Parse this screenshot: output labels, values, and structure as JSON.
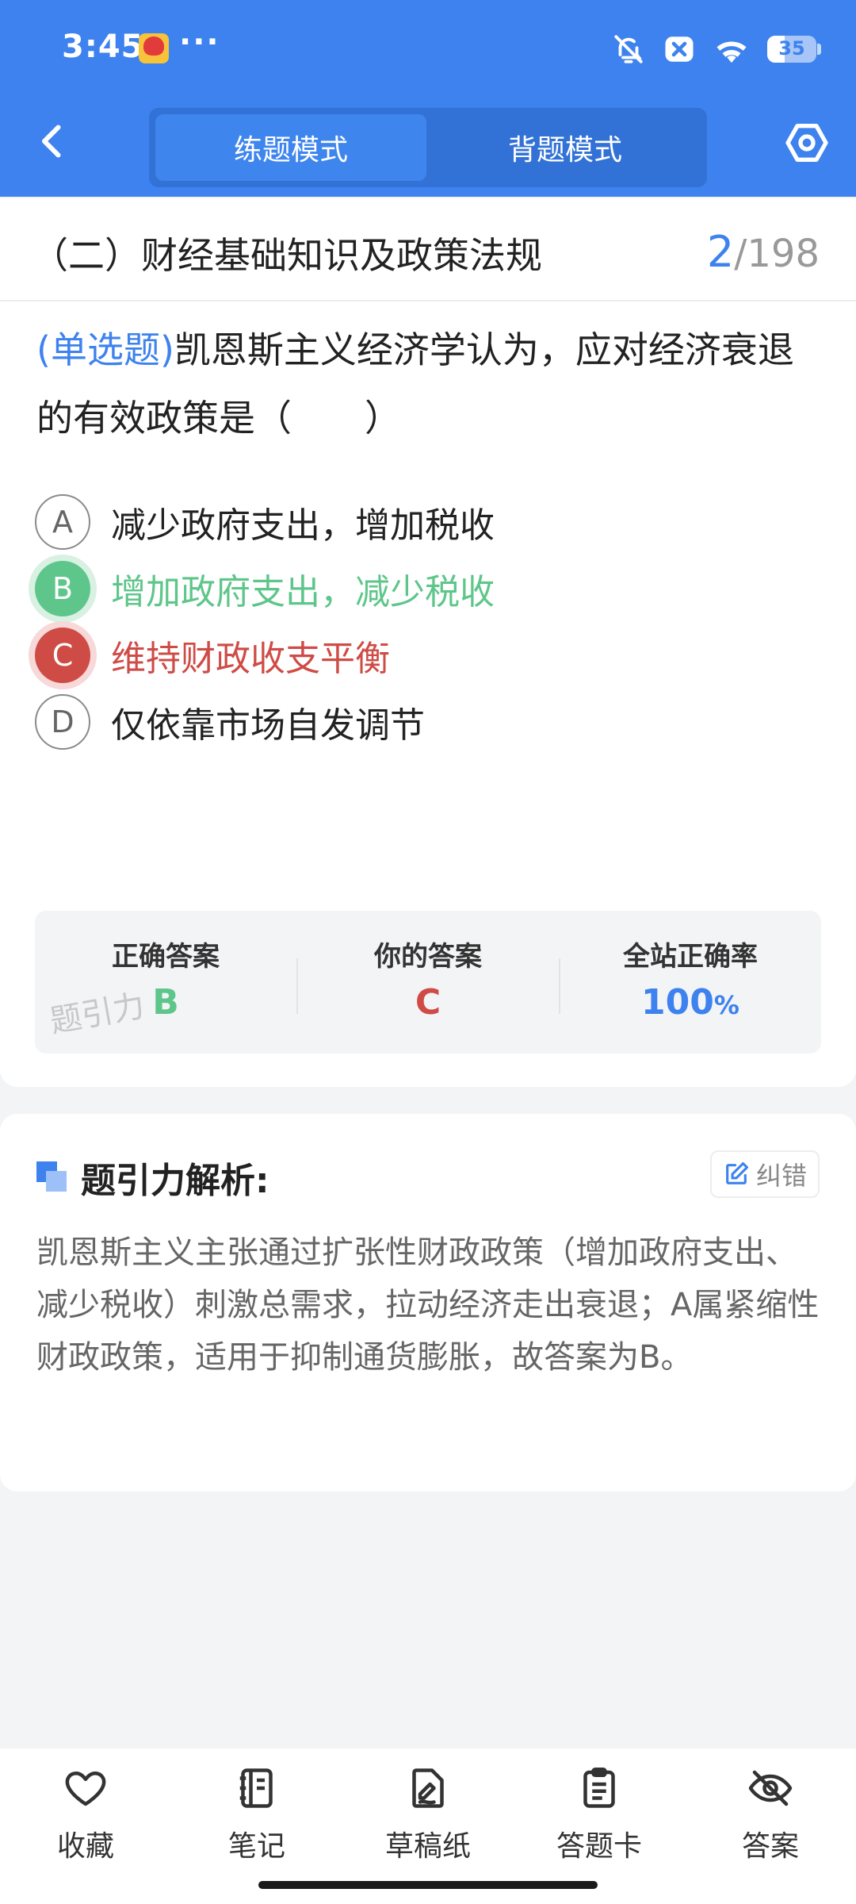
{
  "status_bar": {
    "time": "3:45",
    "more": "···",
    "battery_level": "35"
  },
  "nav": {
    "mode_practice": "练题模式",
    "mode_memorize": "背题模式",
    "active_mode": "练题模式"
  },
  "question": {
    "chapter": "（二）财经基础知识及政策法规",
    "current": "2",
    "total": "/198",
    "type_label": "(单选题)",
    "text": "凯恩斯主义经济学认为，应对经济衰退的有效政策是（　　）",
    "options": [
      {
        "letter": "A",
        "text": "减少政府支出，增加税收",
        "state": "normal"
      },
      {
        "letter": "B",
        "text": "增加政府支出，减少税收",
        "state": "correct"
      },
      {
        "letter": "C",
        "text": "维持财政收支平衡",
        "state": "wrong"
      },
      {
        "letter": "D",
        "text": "仅依靠市场自发调节",
        "state": "normal"
      }
    ]
  },
  "stats": {
    "correct_label": "正确答案",
    "correct_value": "B",
    "yours_label": "你的答案",
    "yours_value": "C",
    "rate_label": "全站正确率",
    "rate_value": "100",
    "rate_unit": "%",
    "watermark": "题引力"
  },
  "analysis": {
    "title": "题引力解析:",
    "report_label": "纠错",
    "text": "凯恩斯主义主张通过扩张性财政政策（增加政府支出、减少税收）刺激总需求，拉动经济走出衰退；A属紧缩性财政政策，适用于抑制通货膨胀，故答案为B。"
  },
  "toolbar": [
    {
      "label": "收藏",
      "icon": "heart-icon"
    },
    {
      "label": "笔记",
      "icon": "notebook-icon"
    },
    {
      "label": "草稿纸",
      "icon": "draft-icon"
    },
    {
      "label": "答题卡",
      "icon": "clipboard-icon"
    },
    {
      "label": "答案",
      "icon": "eye-off-icon"
    }
  ],
  "colors": {
    "primary": "#3d82ee",
    "correct": "#5ec68a",
    "wrong": "#cf4b46",
    "background": "#f3f4f6"
  }
}
